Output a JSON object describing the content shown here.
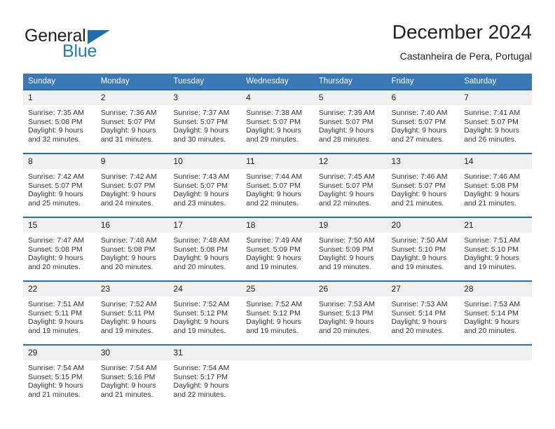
{
  "logo": {
    "word1": "General",
    "word2": "Blue",
    "triangle_icon": "triangle-icon",
    "color_dark": "#231f20",
    "color_blue": "#1f7ac0"
  },
  "header": {
    "title": "December 2024",
    "subtitle": "Castanheira de Pera, Portugal"
  },
  "theme": {
    "header_bg": "#3a79b8",
    "row_border": "#2b6cad",
    "daynum_bg": "#f0f0f0"
  },
  "weekdays": [
    "Sunday",
    "Monday",
    "Tuesday",
    "Wednesday",
    "Thursday",
    "Friday",
    "Saturday"
  ],
  "weeks": [
    [
      {
        "day": "1",
        "sunrise": "Sunrise: 7:35 AM",
        "sunset": "Sunset: 5:08 PM",
        "daylight1": "Daylight: 9 hours",
        "daylight2": "and 32 minutes."
      },
      {
        "day": "2",
        "sunrise": "Sunrise: 7:36 AM",
        "sunset": "Sunset: 5:07 PM",
        "daylight1": "Daylight: 9 hours",
        "daylight2": "and 31 minutes."
      },
      {
        "day": "3",
        "sunrise": "Sunrise: 7:37 AM",
        "sunset": "Sunset: 5:07 PM",
        "daylight1": "Daylight: 9 hours",
        "daylight2": "and 30 minutes."
      },
      {
        "day": "4",
        "sunrise": "Sunrise: 7:38 AM",
        "sunset": "Sunset: 5:07 PM",
        "daylight1": "Daylight: 9 hours",
        "daylight2": "and 29 minutes."
      },
      {
        "day": "5",
        "sunrise": "Sunrise: 7:39 AM",
        "sunset": "Sunset: 5:07 PM",
        "daylight1": "Daylight: 9 hours",
        "daylight2": "and 28 minutes."
      },
      {
        "day": "6",
        "sunrise": "Sunrise: 7:40 AM",
        "sunset": "Sunset: 5:07 PM",
        "daylight1": "Daylight: 9 hours",
        "daylight2": "and 27 minutes."
      },
      {
        "day": "7",
        "sunrise": "Sunrise: 7:41 AM",
        "sunset": "Sunset: 5:07 PM",
        "daylight1": "Daylight: 9 hours",
        "daylight2": "and 26 minutes."
      }
    ],
    [
      {
        "day": "8",
        "sunrise": "Sunrise: 7:42 AM",
        "sunset": "Sunset: 5:07 PM",
        "daylight1": "Daylight: 9 hours",
        "daylight2": "and 25 minutes."
      },
      {
        "day": "9",
        "sunrise": "Sunrise: 7:42 AM",
        "sunset": "Sunset: 5:07 PM",
        "daylight1": "Daylight: 9 hours",
        "daylight2": "and 24 minutes."
      },
      {
        "day": "10",
        "sunrise": "Sunrise: 7:43 AM",
        "sunset": "Sunset: 5:07 PM",
        "daylight1": "Daylight: 9 hours",
        "daylight2": "and 23 minutes."
      },
      {
        "day": "11",
        "sunrise": "Sunrise: 7:44 AM",
        "sunset": "Sunset: 5:07 PM",
        "daylight1": "Daylight: 9 hours",
        "daylight2": "and 22 minutes."
      },
      {
        "day": "12",
        "sunrise": "Sunrise: 7:45 AM",
        "sunset": "Sunset: 5:07 PM",
        "daylight1": "Daylight: 9 hours",
        "daylight2": "and 22 minutes."
      },
      {
        "day": "13",
        "sunrise": "Sunrise: 7:46 AM",
        "sunset": "Sunset: 5:07 PM",
        "daylight1": "Daylight: 9 hours",
        "daylight2": "and 21 minutes."
      },
      {
        "day": "14",
        "sunrise": "Sunrise: 7:46 AM",
        "sunset": "Sunset: 5:08 PM",
        "daylight1": "Daylight: 9 hours",
        "daylight2": "and 21 minutes."
      }
    ],
    [
      {
        "day": "15",
        "sunrise": "Sunrise: 7:47 AM",
        "sunset": "Sunset: 5:08 PM",
        "daylight1": "Daylight: 9 hours",
        "daylight2": "and 20 minutes."
      },
      {
        "day": "16",
        "sunrise": "Sunrise: 7:48 AM",
        "sunset": "Sunset: 5:08 PM",
        "daylight1": "Daylight: 9 hours",
        "daylight2": "and 20 minutes."
      },
      {
        "day": "17",
        "sunrise": "Sunrise: 7:48 AM",
        "sunset": "Sunset: 5:08 PM",
        "daylight1": "Daylight: 9 hours",
        "daylight2": "and 20 minutes."
      },
      {
        "day": "18",
        "sunrise": "Sunrise: 7:49 AM",
        "sunset": "Sunset: 5:09 PM",
        "daylight1": "Daylight: 9 hours",
        "daylight2": "and 19 minutes."
      },
      {
        "day": "19",
        "sunrise": "Sunrise: 7:50 AM",
        "sunset": "Sunset: 5:09 PM",
        "daylight1": "Daylight: 9 hours",
        "daylight2": "and 19 minutes."
      },
      {
        "day": "20",
        "sunrise": "Sunrise: 7:50 AM",
        "sunset": "Sunset: 5:10 PM",
        "daylight1": "Daylight: 9 hours",
        "daylight2": "and 19 minutes."
      },
      {
        "day": "21",
        "sunrise": "Sunrise: 7:51 AM",
        "sunset": "Sunset: 5:10 PM",
        "daylight1": "Daylight: 9 hours",
        "daylight2": "and 19 minutes."
      }
    ],
    [
      {
        "day": "22",
        "sunrise": "Sunrise: 7:51 AM",
        "sunset": "Sunset: 5:11 PM",
        "daylight1": "Daylight: 9 hours",
        "daylight2": "and 19 minutes."
      },
      {
        "day": "23",
        "sunrise": "Sunrise: 7:52 AM",
        "sunset": "Sunset: 5:11 PM",
        "daylight1": "Daylight: 9 hours",
        "daylight2": "and 19 minutes."
      },
      {
        "day": "24",
        "sunrise": "Sunrise: 7:52 AM",
        "sunset": "Sunset: 5:12 PM",
        "daylight1": "Daylight: 9 hours",
        "daylight2": "and 19 minutes."
      },
      {
        "day": "25",
        "sunrise": "Sunrise: 7:52 AM",
        "sunset": "Sunset: 5:12 PM",
        "daylight1": "Daylight: 9 hours",
        "daylight2": "and 19 minutes."
      },
      {
        "day": "26",
        "sunrise": "Sunrise: 7:53 AM",
        "sunset": "Sunset: 5:13 PM",
        "daylight1": "Daylight: 9 hours",
        "daylight2": "and 20 minutes."
      },
      {
        "day": "27",
        "sunrise": "Sunrise: 7:53 AM",
        "sunset": "Sunset: 5:14 PM",
        "daylight1": "Daylight: 9 hours",
        "daylight2": "and 20 minutes."
      },
      {
        "day": "28",
        "sunrise": "Sunrise: 7:53 AM",
        "sunset": "Sunset: 5:14 PM",
        "daylight1": "Daylight: 9 hours",
        "daylight2": "and 20 minutes."
      }
    ],
    [
      {
        "day": "29",
        "sunrise": "Sunrise: 7:54 AM",
        "sunset": "Sunset: 5:15 PM",
        "daylight1": "Daylight: 9 hours",
        "daylight2": "and 21 minutes."
      },
      {
        "day": "30",
        "sunrise": "Sunrise: 7:54 AM",
        "sunset": "Sunset: 5:16 PM",
        "daylight1": "Daylight: 9 hours",
        "daylight2": "and 21 minutes."
      },
      {
        "day": "31",
        "sunrise": "Sunrise: 7:54 AM",
        "sunset": "Sunset: 5:17 PM",
        "daylight1": "Daylight: 9 hours",
        "daylight2": "and 22 minutes."
      },
      {
        "day": "",
        "sunrise": "",
        "sunset": "",
        "daylight1": "",
        "daylight2": ""
      },
      {
        "day": "",
        "sunrise": "",
        "sunset": "",
        "daylight1": "",
        "daylight2": ""
      },
      {
        "day": "",
        "sunrise": "",
        "sunset": "",
        "daylight1": "",
        "daylight2": ""
      },
      {
        "day": "",
        "sunrise": "",
        "sunset": "",
        "daylight1": "",
        "daylight2": ""
      }
    ]
  ]
}
